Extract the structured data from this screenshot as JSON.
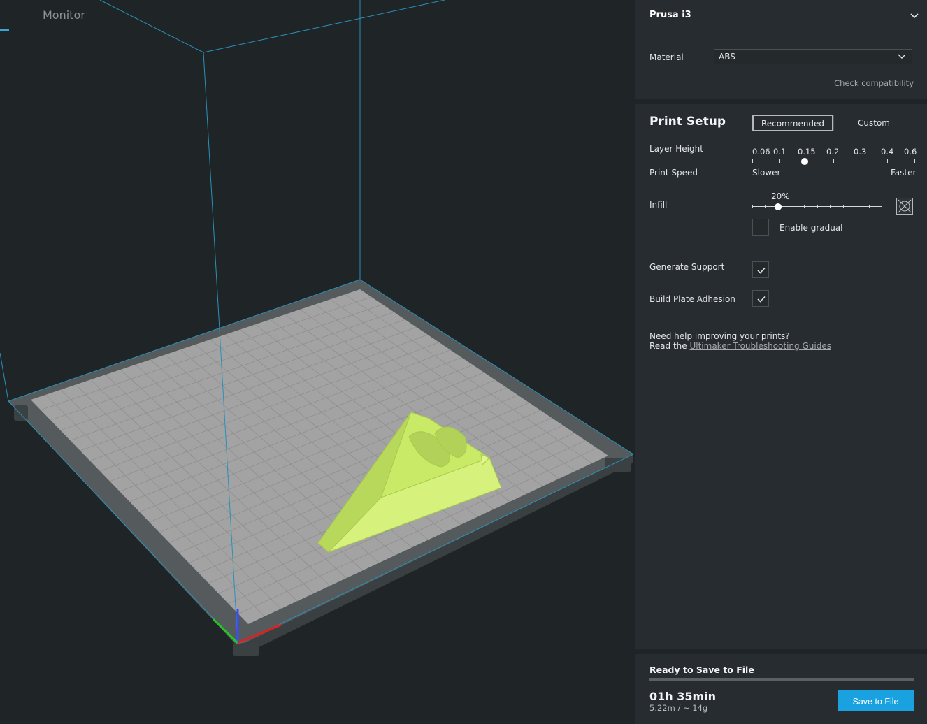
{
  "header": {
    "monitor_tab": "Monitor"
  },
  "printer": {
    "name": "Prusa i3"
  },
  "material": {
    "label": "Material",
    "value": "ABS",
    "check_link": "Check compatibility"
  },
  "print_setup": {
    "title": "Print Setup",
    "modes": [
      "Recommended",
      "Custom"
    ],
    "active_mode": "Recommended",
    "layer_height": {
      "label": "Layer Height",
      "ticks": [
        "0.06",
        "0.1",
        "0.15",
        "0.2",
        "0.3",
        "0.4",
        "0.6"
      ],
      "selected": "0.15"
    },
    "print_speed": {
      "label": "Print Speed",
      "slower": "Slower",
      "faster": "Faster"
    },
    "infill": {
      "label": "Infill",
      "value": "20%",
      "fraction": 0.2,
      "gradual_label": "Enable gradual",
      "gradual_checked": false
    },
    "support": {
      "label": "Generate Support",
      "checked": true
    },
    "adhesion": {
      "label": "Build Plate Adhesion",
      "checked": true
    },
    "help_line1": "Need help improving your prints?",
    "help_prefix": "Read the ",
    "help_link": "Ultimaker Troubleshooting Guides"
  },
  "job": {
    "status": "Ready to Save to File",
    "time": "01h 35min",
    "usage": "5.22m / ~ 14g",
    "save_label": "Save to File"
  },
  "colors": {
    "accent": "#1aa1e0",
    "model": "#c8ea67",
    "build_volume": "#2a90b8"
  }
}
